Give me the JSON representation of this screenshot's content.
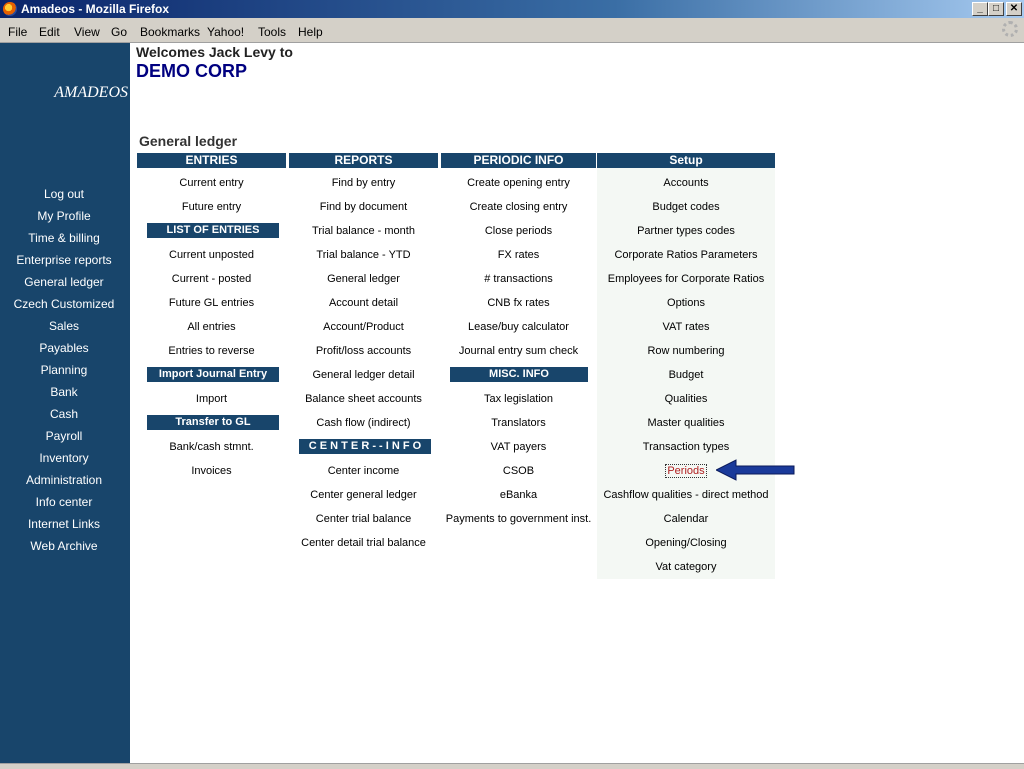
{
  "window": {
    "title": "Amadeos - Mozilla Firefox"
  },
  "menu": [
    "File",
    "Edit",
    "View",
    "Go",
    "Bookmarks",
    "Yahoo!",
    "Tools",
    "Help"
  ],
  "sidebar": {
    "logo": "AMADEOS",
    "items": [
      "Log out",
      "My Profile",
      "Time & billing",
      "Enterprise reports",
      "General ledger",
      "Czech Customized",
      "Sales",
      "Payables",
      "Planning",
      "Bank",
      "Cash",
      "Payroll",
      "Inventory",
      "Administration",
      "Info center",
      "Internet Links",
      "Web Archive"
    ]
  },
  "header": {
    "welcome": "Welcomes Jack Levy to",
    "company": "DEMO CORP"
  },
  "section": {
    "title": "General ledger"
  },
  "columns": {
    "entries": {
      "header": "ENTRIES",
      "items": [
        "Current entry",
        "Future entry"
      ],
      "list_header": "LIST OF ENTRIES",
      "list_items": [
        "Current unposted",
        "Current - posted",
        "Future GL entries",
        "All entries",
        "Entries to reverse"
      ],
      "import_header": "Import Journal Entry",
      "import_items": [
        "Import"
      ],
      "transfer_header": "Transfer to GL",
      "transfer_items": [
        "Bank/cash stmnt.",
        "Invoices"
      ]
    },
    "reports": {
      "header": "REPORTS",
      "items": [
        "Find by entry",
        "Find by document",
        "Trial balance - month",
        "Trial balance - YTD",
        "General ledger",
        "Account detail",
        "Account/Product",
        "Profit/loss accounts",
        "General ledger detail",
        "Balance sheet accounts",
        "Cash flow (indirect)"
      ],
      "center_header": "C E N T E R - - I N F O",
      "center_items": [
        "Center income",
        "Center general ledger",
        "Center trial balance",
        "Center detail trial balance"
      ]
    },
    "periodic": {
      "header": "PERIODIC INFO",
      "items": [
        "Create opening entry",
        "Create closing entry",
        "Close periods",
        "FX rates",
        "# transactions",
        "CNB fx rates",
        "Lease/buy calculator",
        "Journal entry sum check"
      ],
      "misc_header": "MISC. INFO",
      "misc_items": [
        "Tax legislation",
        "Translators",
        "VAT payers",
        "CSOB",
        "eBanka",
        "Payments to government inst."
      ]
    },
    "setup": {
      "header": "Setup",
      "items": [
        "Accounts",
        "Budget codes",
        "Partner types codes",
        "Corporate Ratios Parameters",
        "Employees for Corporate Ratios",
        "Options",
        "VAT rates",
        "Row numbering",
        "Budget",
        "Qualities",
        "Master qualities",
        "Transaction types",
        "Periods",
        "Cashflow qualities - direct method",
        "Calendar",
        "Opening/Closing",
        "Vat category"
      ]
    }
  },
  "colors": {
    "sidebar": "#18456b",
    "company": "#000080",
    "arrow": "#1a3a9a"
  },
  "icons": [
    "firefox-icon",
    "minimize-icon",
    "maximize-icon",
    "close-icon",
    "throbber-icon",
    "arrow-icon"
  ]
}
